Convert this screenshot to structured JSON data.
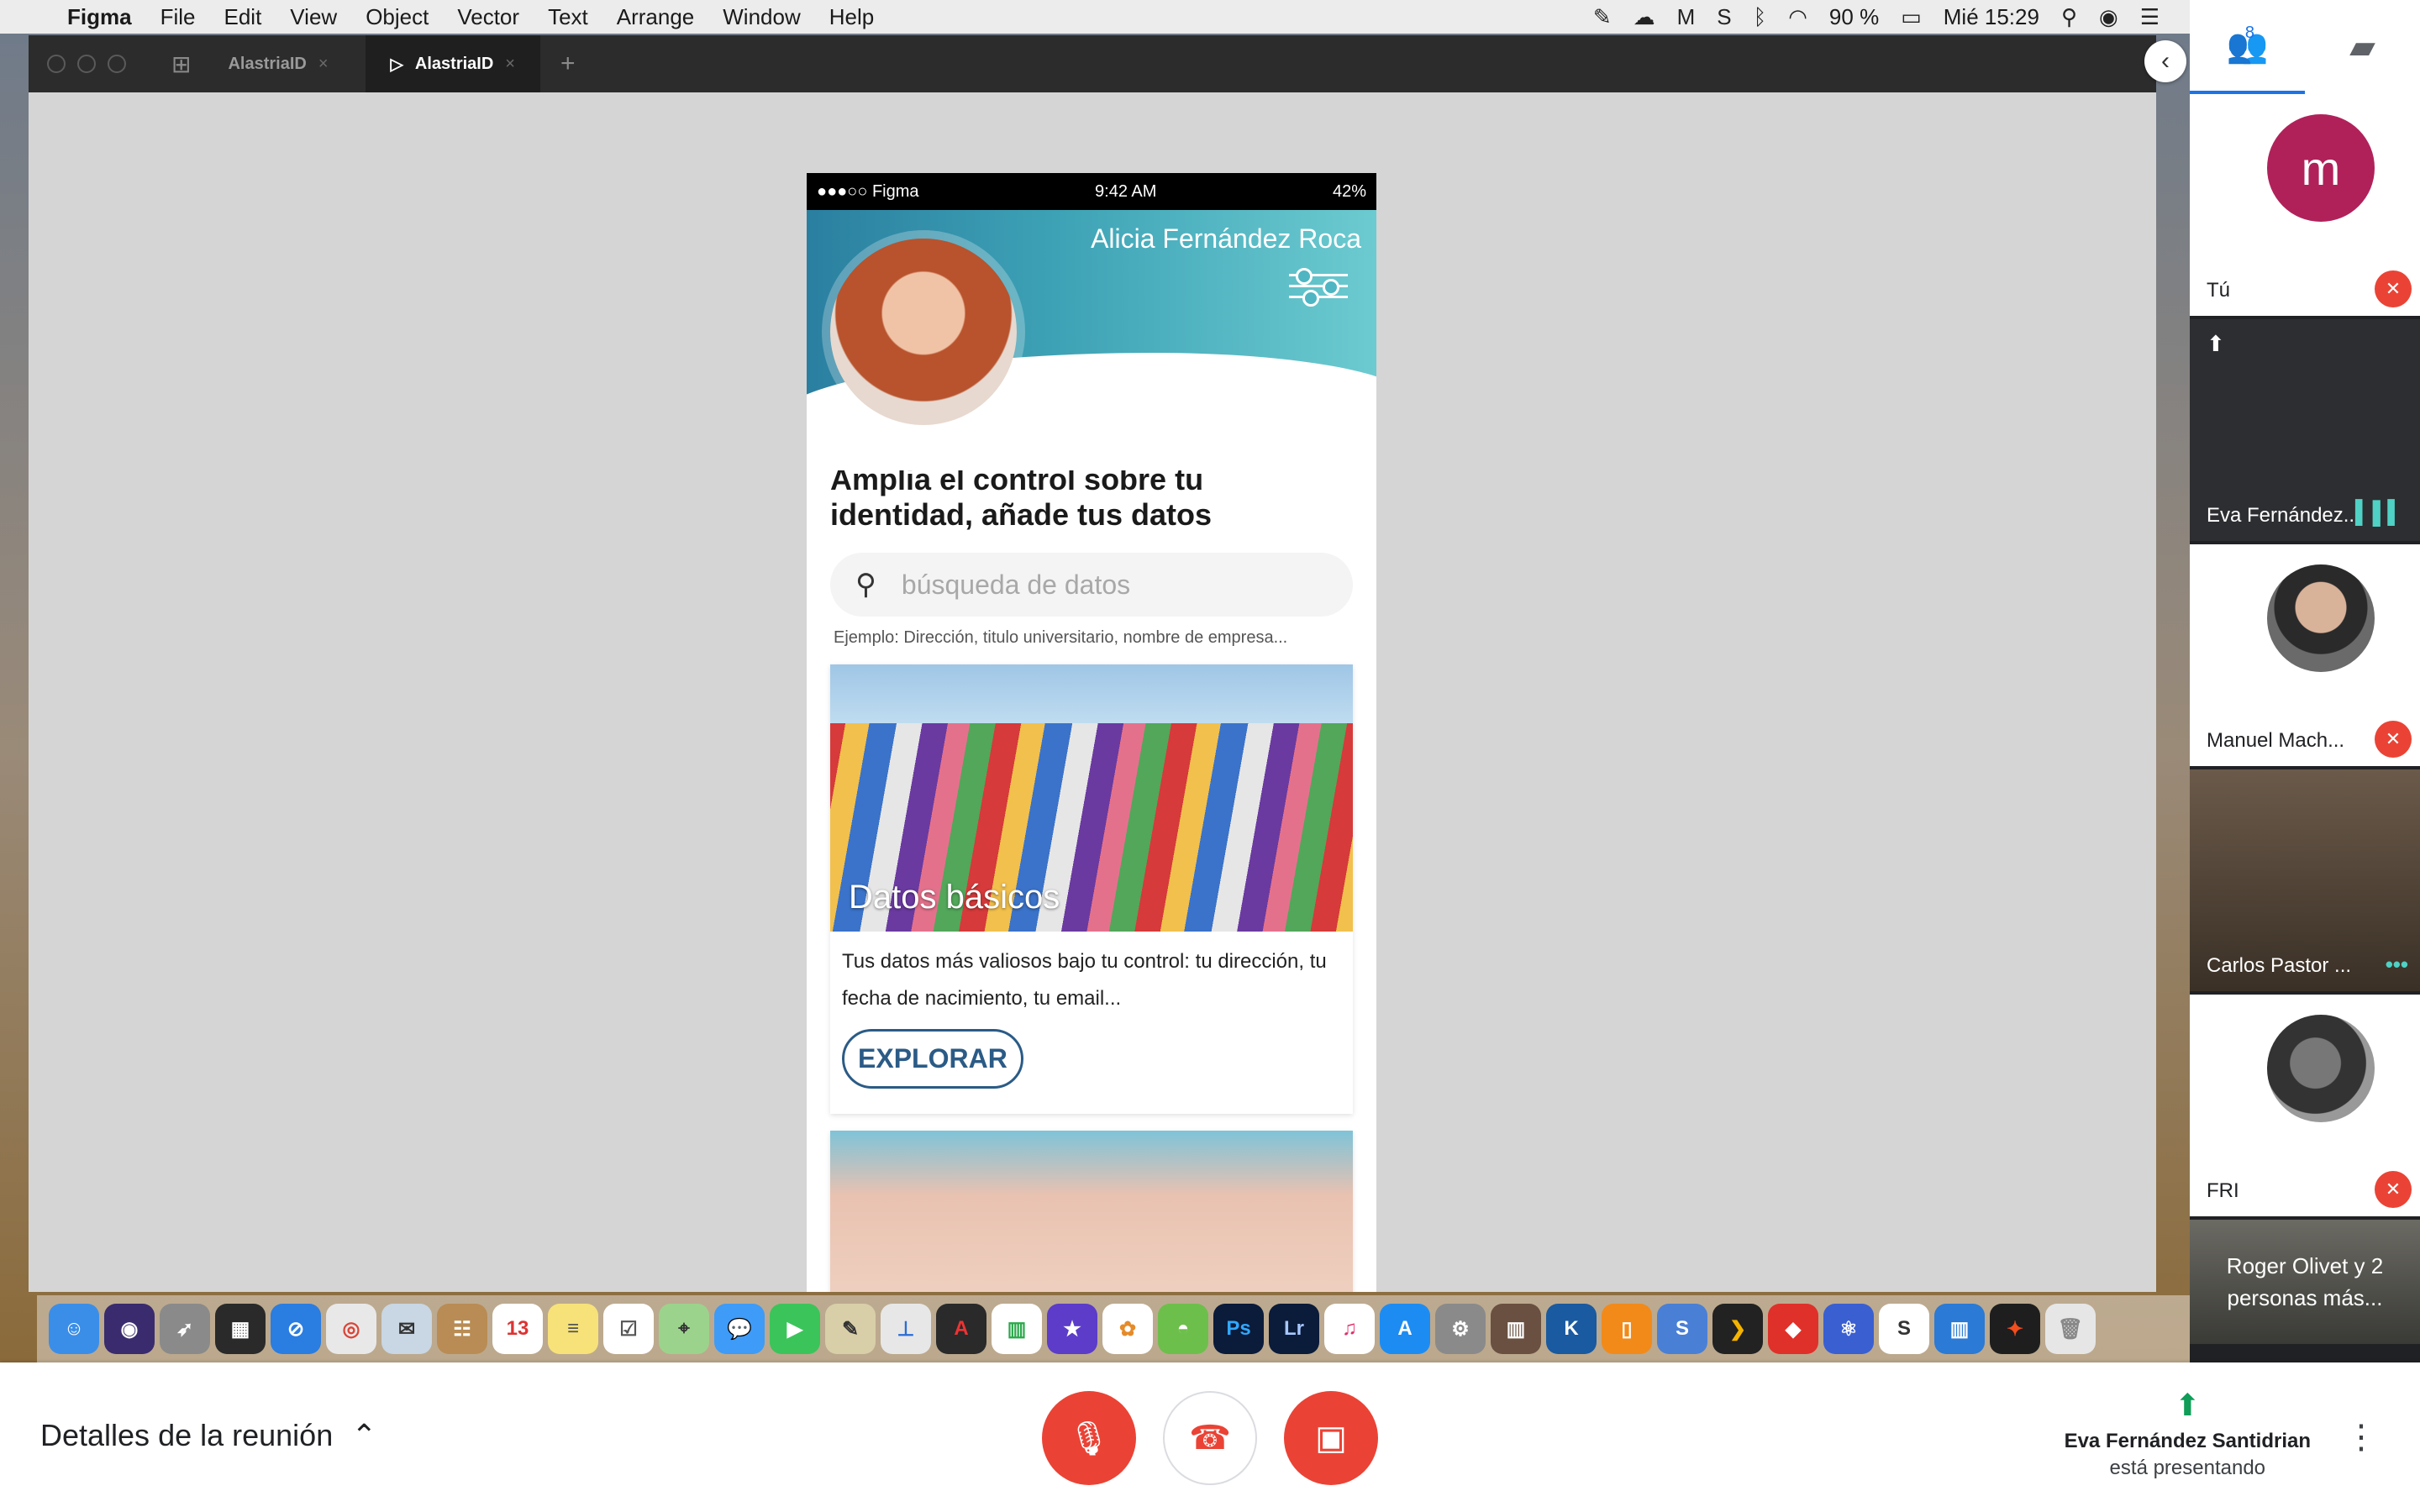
{
  "menubar": {
    "items": [
      "Figma",
      "File",
      "Edit",
      "View",
      "Object",
      "Vector",
      "Text",
      "Arrange",
      "Window",
      "Help"
    ],
    "battery": "90 %",
    "clock": "Mié 15:29"
  },
  "figma": {
    "tabs": [
      {
        "label": "AlastriaID"
      },
      {
        "label": "AlastriaID"
      }
    ]
  },
  "phone": {
    "carrier": "●●●○○ Figma",
    "time": "9:42 AM",
    "battery": "42%",
    "profile_name": "Alicia Fernández Roca",
    "headline": "Amplia el control sobre tu identidad, añade tus datos",
    "search_placeholder": "búsqueda de datos",
    "example": "Ejemplo: Dirección, titulo universitario, nombre de empresa...",
    "card": {
      "title": "Datos básicos",
      "text": "Tus datos más valiosos bajo tu control: tu dirección, tu fecha de nacimiento, tu email...",
      "button": "EXPLORAR"
    }
  },
  "participants": {
    "count": "8",
    "tiles": [
      {
        "name": "Tú",
        "initial": "m"
      },
      {
        "name": "Eva Fernández..."
      },
      {
        "name": "Manuel Mach..."
      },
      {
        "name": "Carlos Pastor ..."
      },
      {
        "name": "FRI"
      }
    ],
    "overflow": "Roger Olivet y 2 personas más..."
  },
  "meetbar": {
    "details": "Detalles de la reunión",
    "presenter_name": "Eva Fernández Santidrian",
    "presenter_status": "está presentando"
  },
  "colors": {
    "accent": "#1a73e8",
    "danger": "#ea4335",
    "present": "#0f9d58",
    "explore": "#2b5b86"
  }
}
